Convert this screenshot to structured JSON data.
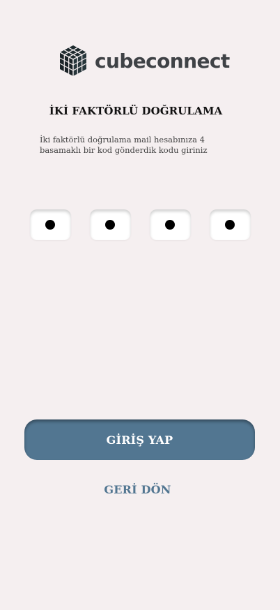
{
  "brand": {
    "name": "cubeconnect",
    "icon": "cube-logo-icon"
  },
  "auth": {
    "title": "İKİ FAKTÖRLÜ DOĞRULAMA",
    "instructions": "İki faktörlü doğrulama mail hesabınıza 4 basamaklı bir kod gönderdik kodu giriniz",
    "code_digits": [
      {
        "state": "filled",
        "display": "●"
      },
      {
        "state": "filled",
        "display": "●"
      },
      {
        "state": "filled",
        "display": "●"
      },
      {
        "state": "filled",
        "display": "●"
      }
    ]
  },
  "actions": {
    "login_label": "GİRİŞ YAP",
    "back_label": "GERİ DÖN"
  },
  "colors": {
    "background": "#f5eff0",
    "primary": "#527691",
    "logo_text": "#3f4246",
    "logo_icon": "#1f2b2f"
  }
}
